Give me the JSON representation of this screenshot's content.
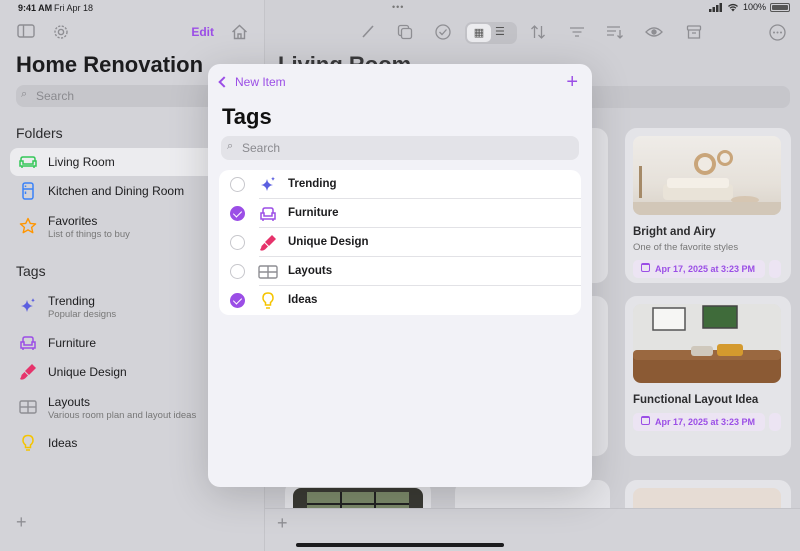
{
  "status": {
    "time": "9:41 AM",
    "date": "Fri Apr 18",
    "battery": "100%"
  },
  "sidebar": {
    "edit_label": "Edit",
    "title": "Home Renovation",
    "search_placeholder": "Search",
    "folders_heading": "Folders",
    "folders": [
      {
        "label": "Living Room",
        "subtitle": "",
        "icon": "sofa-icon",
        "color": "#34c759",
        "selected": true
      },
      {
        "label": "Kitchen and Dining Room",
        "subtitle": "",
        "icon": "fridge-icon",
        "color": "#3a82f7",
        "selected": false
      },
      {
        "label": "Favorites",
        "subtitle": "List of things to buy",
        "icon": "star-icon",
        "color": "#ff9500",
        "selected": false
      }
    ],
    "tags_heading": "Tags",
    "tags": [
      {
        "label": "Trending",
        "subtitle": "Popular designs",
        "icon": "sparkles-icon",
        "color": "#5b5fe0"
      },
      {
        "label": "Furniture",
        "subtitle": "",
        "icon": "armchair-icon",
        "color": "#9b4ee6"
      },
      {
        "label": "Unique Design",
        "subtitle": "",
        "icon": "paintbrush-icon",
        "color": "#e6336b"
      },
      {
        "label": "Layouts",
        "subtitle": "Various room plan and layout ideas",
        "icon": "layout-icon",
        "color": "#8e8e93"
      },
      {
        "label": "Ideas",
        "subtitle": "",
        "icon": "lightbulb-icon",
        "color": "#f5c400"
      }
    ]
  },
  "main": {
    "title": "Living Room",
    "cards": [
      {
        "title": "Bright and Airy",
        "subtitle": "One of the favorite styles",
        "date": "Apr 17, 2025 at 3:23 PM"
      },
      {
        "title": "Functional Layout Idea",
        "subtitle": "",
        "date": "Apr 17, 2025 at 3:23 PM"
      }
    ]
  },
  "modal": {
    "back_label": "New Item",
    "title": "Tags",
    "search_placeholder": "Search",
    "tags": [
      {
        "label": "Trending",
        "selected": false,
        "icon": "sparkles-icon",
        "color": "#5b5fe0"
      },
      {
        "label": "Furniture",
        "selected": true,
        "icon": "armchair-icon",
        "color": "#9b4ee6"
      },
      {
        "label": "Unique Design",
        "selected": false,
        "icon": "paintbrush-icon",
        "color": "#e6336b"
      },
      {
        "label": "Layouts",
        "selected": false,
        "icon": "layout-icon",
        "color": "#8e8e93"
      },
      {
        "label": "Ideas",
        "selected": true,
        "icon": "lightbulb-icon",
        "color": "#f5c400"
      }
    ]
  },
  "colors": {
    "accent": "#9b4ee6"
  }
}
